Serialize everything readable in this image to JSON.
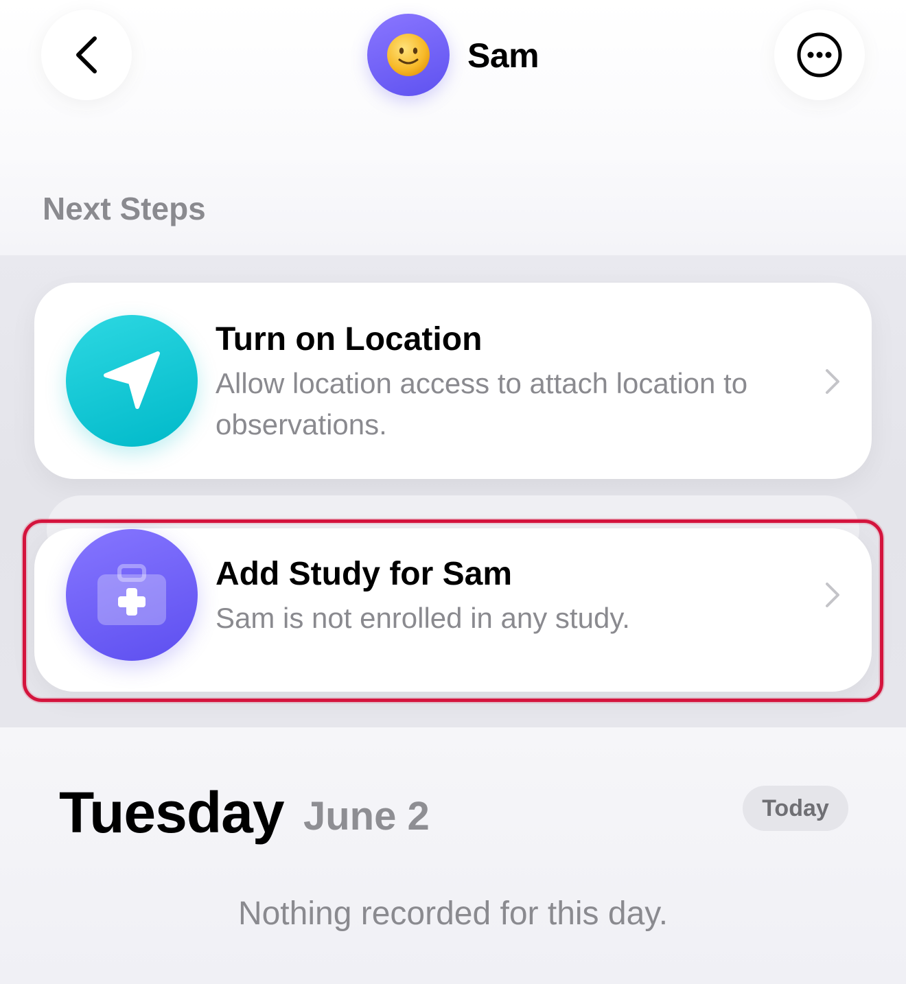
{
  "header": {
    "name": "Sam",
    "avatar_emoji": "🙂",
    "back_icon": "chevron-left-icon",
    "more_icon": "ellipsis-circle-icon"
  },
  "next_steps": {
    "title": "Next Steps",
    "cards": [
      {
        "title": "Turn on Location",
        "subtitle": "Allow location access to attach location to observations.",
        "icon": "location-arrow-icon",
        "color": "#0bc4d1"
      },
      {
        "title": "Add Study for Sam",
        "subtitle": "Sam is not enrolled in any study.",
        "icon": "medical-briefcase-icon",
        "color": "#6b5cf6"
      }
    ]
  },
  "day": {
    "weekday": "Tuesday",
    "date": "June 2",
    "today_label": "Today",
    "empty_message": "Nothing recorded for this day."
  },
  "colors": {
    "highlight": "#d4143d",
    "secondary_text": "#8a8a8f"
  }
}
